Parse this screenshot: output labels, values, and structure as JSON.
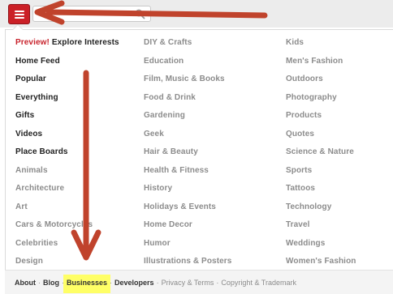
{
  "header": {
    "menu_icon": "hamburger-menu-icon",
    "search_icon": "search-icon",
    "accent_color": "#cb2027"
  },
  "menu": {
    "column1": [
      {
        "prefix": "Preview!",
        "label": "Explore Interests",
        "style": "dark"
      },
      {
        "label": "Home Feed",
        "style": "dark"
      },
      {
        "label": "Popular",
        "style": "dark"
      },
      {
        "label": "Everything",
        "style": "dark"
      },
      {
        "label": "Gifts",
        "style": "dark"
      },
      {
        "label": "Videos",
        "style": "dark"
      },
      {
        "label": "Place Boards",
        "style": "dark"
      },
      {
        "label": "Animals",
        "style": "gray"
      },
      {
        "label": "Architecture",
        "style": "gray"
      },
      {
        "label": "Art",
        "style": "gray"
      },
      {
        "label": "Cars & Motorcycles",
        "style": "gray"
      },
      {
        "label": "Celebrities",
        "style": "gray"
      },
      {
        "label": "Design",
        "style": "gray"
      }
    ],
    "column2": [
      {
        "label": "DIY & Crafts"
      },
      {
        "label": "Education"
      },
      {
        "label": "Film, Music & Books"
      },
      {
        "label": "Food & Drink"
      },
      {
        "label": "Gardening"
      },
      {
        "label": "Geek"
      },
      {
        "label": "Hair & Beauty"
      },
      {
        "label": "Health & Fitness"
      },
      {
        "label": "History"
      },
      {
        "label": "Holidays & Events"
      },
      {
        "label": "Home Decor"
      },
      {
        "label": "Humor"
      },
      {
        "label": "Illustrations & Posters"
      }
    ],
    "column3": [
      {
        "label": "Kids"
      },
      {
        "label": "Men's Fashion"
      },
      {
        "label": "Outdoors"
      },
      {
        "label": "Photography"
      },
      {
        "label": "Products"
      },
      {
        "label": "Quotes"
      },
      {
        "label": "Science & Nature"
      },
      {
        "label": "Sports"
      },
      {
        "label": "Tattoos"
      },
      {
        "label": "Technology"
      },
      {
        "label": "Travel"
      },
      {
        "label": "Weddings"
      },
      {
        "label": "Women's Fashion"
      }
    ]
  },
  "footer": {
    "about": "About",
    "blog": "Blog",
    "businesses": "Businesses",
    "developers": "Developers",
    "privacy_terms": "Privacy & Terms",
    "copyright": "Copyright & Trademark",
    "separator": "·",
    "highlight_color": "#ffff66"
  },
  "annotations": {
    "arrow_color": "#c0432c"
  }
}
